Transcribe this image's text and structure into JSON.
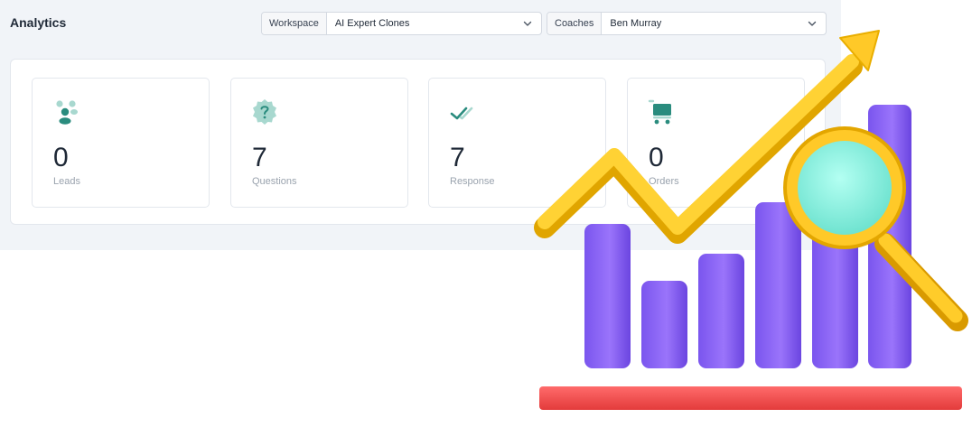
{
  "header": {
    "title": "Analytics",
    "workspace_label": "Workspace",
    "workspace_value": "AI Expert Clones",
    "coaches_label": "Coaches",
    "coaches_value": "Ben Murray"
  },
  "stats": [
    {
      "value": "0",
      "label": "Leads",
      "icon": "people-icon"
    },
    {
      "value": "7",
      "label": "Questions",
      "icon": "question-badge-icon"
    },
    {
      "value": "7",
      "label": "Response",
      "icon": "double-check-icon"
    },
    {
      "value": "0",
      "label": "Orders",
      "icon": "cart-icon"
    }
  ],
  "colors": {
    "accent": "#2a8c7e",
    "accent_light": "#a8d8cf",
    "background": "#f1f4f8",
    "bar": "#8a63f2",
    "arrow": "#ffc928",
    "baseline": "#f35353",
    "lens": "#8ef1e0"
  },
  "illustration": "growth-chart-magnifier-illustration"
}
